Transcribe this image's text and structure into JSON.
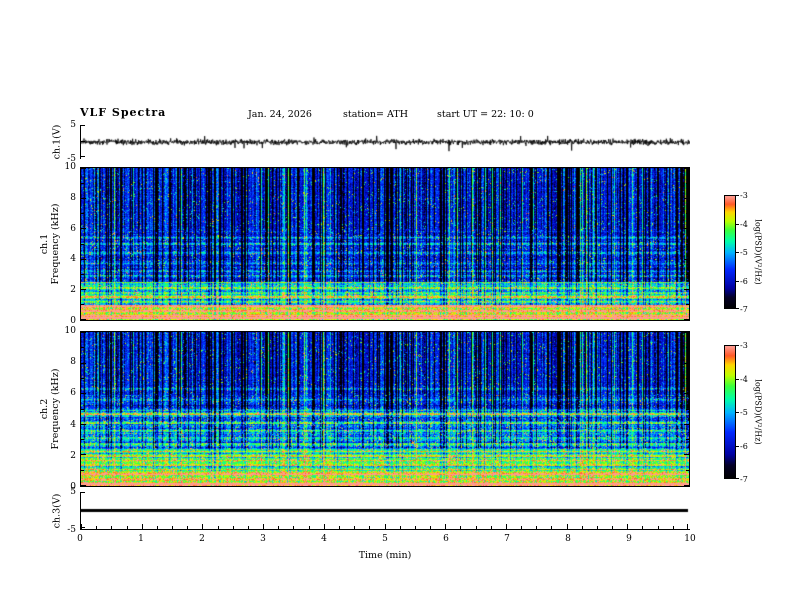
{
  "header": {
    "title": "VLF  Spectra",
    "date": "Jan. 24, 2026",
    "station": "station= ATH",
    "start_ut": "start UT =   22: 10: 0"
  },
  "xaxis": {
    "label": "Time  (min)",
    "ticks": [
      "0",
      "1",
      "2",
      "3",
      "4",
      "5",
      "6",
      "7",
      "8",
      "9",
      "10"
    ],
    "range": [
      0,
      10
    ]
  },
  "panels": {
    "wave1": {
      "ylabel": "ch.1(V)",
      "yticks": [
        "5",
        "-5"
      ],
      "range": [
        -5,
        5
      ]
    },
    "spec1": {
      "ylabel_ch": "ch.1",
      "ylabel_freq": "Frequency  (kHz)",
      "yticks": [
        "10",
        "8",
        "6",
        "4",
        "2",
        "0"
      ],
      "range": [
        0,
        10
      ]
    },
    "spec2": {
      "ylabel_ch": "ch.2",
      "ylabel_freq": "Frequency  (kHz)",
      "yticks": [
        "10",
        "8",
        "6",
        "4",
        "2",
        "0"
      ],
      "range": [
        0,
        10
      ]
    },
    "wave3": {
      "ylabel": "ch.3(V)",
      "yticks": [
        "5",
        "-5"
      ],
      "range": [
        -5,
        5
      ]
    }
  },
  "colorbar": {
    "label": "log(PSD)(V²/Hz)",
    "ticks": [
      "-3",
      "-4",
      "-5",
      "-6",
      "-7"
    ],
    "range": [
      -7,
      -3
    ]
  },
  "colormap": {
    "stops": [
      {
        "t": 0.0,
        "c": [
          0,
          0,
          0
        ]
      },
      {
        "t": 0.1,
        "c": [
          5,
          0,
          40
        ]
      },
      {
        "t": 0.18,
        "c": [
          0,
          0,
          160
        ]
      },
      {
        "t": 0.35,
        "c": [
          0,
          40,
          255
        ]
      },
      {
        "t": 0.5,
        "c": [
          0,
          180,
          255
        ]
      },
      {
        "t": 0.6,
        "c": [
          0,
          255,
          170
        ]
      },
      {
        "t": 0.7,
        "c": [
          60,
          255,
          60
        ]
      },
      {
        "t": 0.78,
        "c": [
          190,
          255,
          0
        ]
      },
      {
        "t": 0.86,
        "c": [
          255,
          215,
          0
        ]
      },
      {
        "t": 0.93,
        "c": [
          255,
          90,
          40
        ]
      },
      {
        "t": 1.0,
        "c": [
          255,
          155,
          145
        ]
      }
    ]
  },
  "chart_data": [
    {
      "type": "line",
      "name": "ch1_waveform",
      "ylabel": "ch.1(V)",
      "xlabel": "Time (min)",
      "x_range": [
        0,
        10
      ],
      "y_range": [
        -5,
        5
      ],
      "line_color": "#000000",
      "noise_amp": 0.8,
      "spike_prob": 0.006,
      "description": "Broadband noise of roughly ±1 V about 0 V for the full 10-minute record, with sporadic impulsive spikes reaching about -3 V."
    },
    {
      "type": "heatmap",
      "name": "ch1_spectrogram",
      "x_range": [
        0,
        10
      ],
      "y_range": [
        0,
        10
      ],
      "z_range": [
        -7,
        -3
      ],
      "xlabel": "Time (min)",
      "ylabel": "ch.1 Frequency (kHz)",
      "z_label": "log(PSD)(V²/Hz)",
      "description": "Dense vertical sferic striping (black/dark-blue columns) above ~3 kHz over a deep-blue ~-6.5 background with cyan impulses; discrete horizontal emission lines near 5.4, 5.0, 4.4, 3.7, 3.2 and 2.9 kHz; structured green/cyan banding below 2.5 kHz and yellow-red power near 0 kHz.",
      "bands": [
        {
          "f_min": 6.0,
          "f_max": 10.01,
          "base": 0.28,
          "noise": 0.1,
          "streak": 1.0,
          "speckle": 0.05,
          "banding": 0.03
        },
        {
          "f_min": 2.5,
          "f_max": 6.0,
          "base": 0.3,
          "noise": 0.12,
          "streak": 0.55,
          "speckle": 0.06,
          "banding": 0.06
        },
        {
          "f_min": 1.0,
          "f_max": 2.5,
          "base": 0.52,
          "noise": 0.1,
          "streak": 0.18,
          "speckle": 0.1,
          "banding": 0.16
        },
        {
          "f_min": 0.0,
          "f_max": 1.0,
          "base": 0.7,
          "noise": 0.12,
          "streak": 0.1,
          "speckle": 0.16,
          "banding": 0.12
        }
      ],
      "lines": [
        {
          "f": 5.4,
          "amp": 0.22
        },
        {
          "f": 5.0,
          "amp": 0.25
        },
        {
          "f": 4.4,
          "amp": 0.2
        },
        {
          "f": 3.7,
          "amp": 0.18
        },
        {
          "f": 3.2,
          "amp": 0.2
        },
        {
          "f": 2.9,
          "amp": 0.18
        },
        {
          "f": 2.45,
          "amp": 0.22
        },
        {
          "f": 2.1,
          "amp": 0.25
        },
        {
          "f": 1.75,
          "amp": 0.3
        },
        {
          "f": 1.5,
          "amp": 0.3
        },
        {
          "f": 1.2,
          "amp": 0.28
        },
        {
          "f": 0.9,
          "amp": 0.3
        },
        {
          "f": 0.6,
          "amp": 0.3
        },
        {
          "f": 0.3,
          "amp": 0.35
        },
        {
          "f": 0.12,
          "amp": 0.5
        }
      ]
    },
    {
      "type": "heatmap",
      "name": "ch2_spectrogram",
      "x_range": [
        0,
        10
      ],
      "y_range": [
        0,
        10
      ],
      "z_range": [
        -7,
        -3
      ],
      "xlabel": "Time (min)",
      "ylabel": "ch.2 Frequency (kHz)",
      "z_label": "log(PSD)(V²/Hz)",
      "description": "Same sferic striping above ~5 kHz; stronger structured emissions below 5 kHz with bright yellow-green lines near 4.65, 2.25 and 1.95 kHz, broad green banding 0.5-4 kHz, and yellow-red power near 0 kHz.",
      "bands": [
        {
          "f_min": 6.0,
          "f_max": 10.01,
          "base": 0.28,
          "noise": 0.1,
          "streak": 1.0,
          "speckle": 0.05,
          "banding": 0.03
        },
        {
          "f_min": 5.0,
          "f_max": 6.0,
          "base": 0.3,
          "noise": 0.12,
          "streak": 0.5,
          "speckle": 0.06,
          "banding": 0.08
        },
        {
          "f_min": 2.5,
          "f_max": 5.0,
          "base": 0.45,
          "noise": 0.12,
          "streak": 0.25,
          "speckle": 0.08,
          "banding": 0.12
        },
        {
          "f_min": 1.0,
          "f_max": 2.5,
          "base": 0.56,
          "noise": 0.1,
          "streak": 0.12,
          "speckle": 0.1,
          "banding": 0.15
        },
        {
          "f_min": 0.0,
          "f_max": 1.0,
          "base": 0.7,
          "noise": 0.13,
          "streak": 0.08,
          "speckle": 0.15,
          "banding": 0.12
        }
      ],
      "lines": [
        {
          "f": 6.3,
          "amp": 0.18
        },
        {
          "f": 5.6,
          "amp": 0.16
        },
        {
          "f": 4.65,
          "amp": 0.4
        },
        {
          "f": 4.1,
          "amp": 0.22
        },
        {
          "f": 3.6,
          "amp": 0.2
        },
        {
          "f": 3.1,
          "amp": 0.2
        },
        {
          "f": 2.7,
          "amp": 0.22
        },
        {
          "f": 2.25,
          "amp": 0.38
        },
        {
          "f": 1.95,
          "amp": 0.32
        },
        {
          "f": 1.65,
          "amp": 0.28
        },
        {
          "f": 1.35,
          "amp": 0.28
        },
        {
          "f": 1.05,
          "amp": 0.28
        },
        {
          "f": 0.75,
          "amp": 0.28
        },
        {
          "f": 0.45,
          "amp": 0.32
        },
        {
          "f": 0.12,
          "amp": 0.5
        }
      ]
    },
    {
      "type": "line",
      "name": "ch3_waveform",
      "ylabel": "ch.3(V)",
      "xlabel": "Time (min)",
      "x_range": [
        0,
        10
      ],
      "y_range": [
        -5,
        5
      ],
      "line_color": "#000000",
      "flat_value": 0,
      "description": "Constant 0 V — flat thick black line across the full record (channel inactive)."
    }
  ]
}
